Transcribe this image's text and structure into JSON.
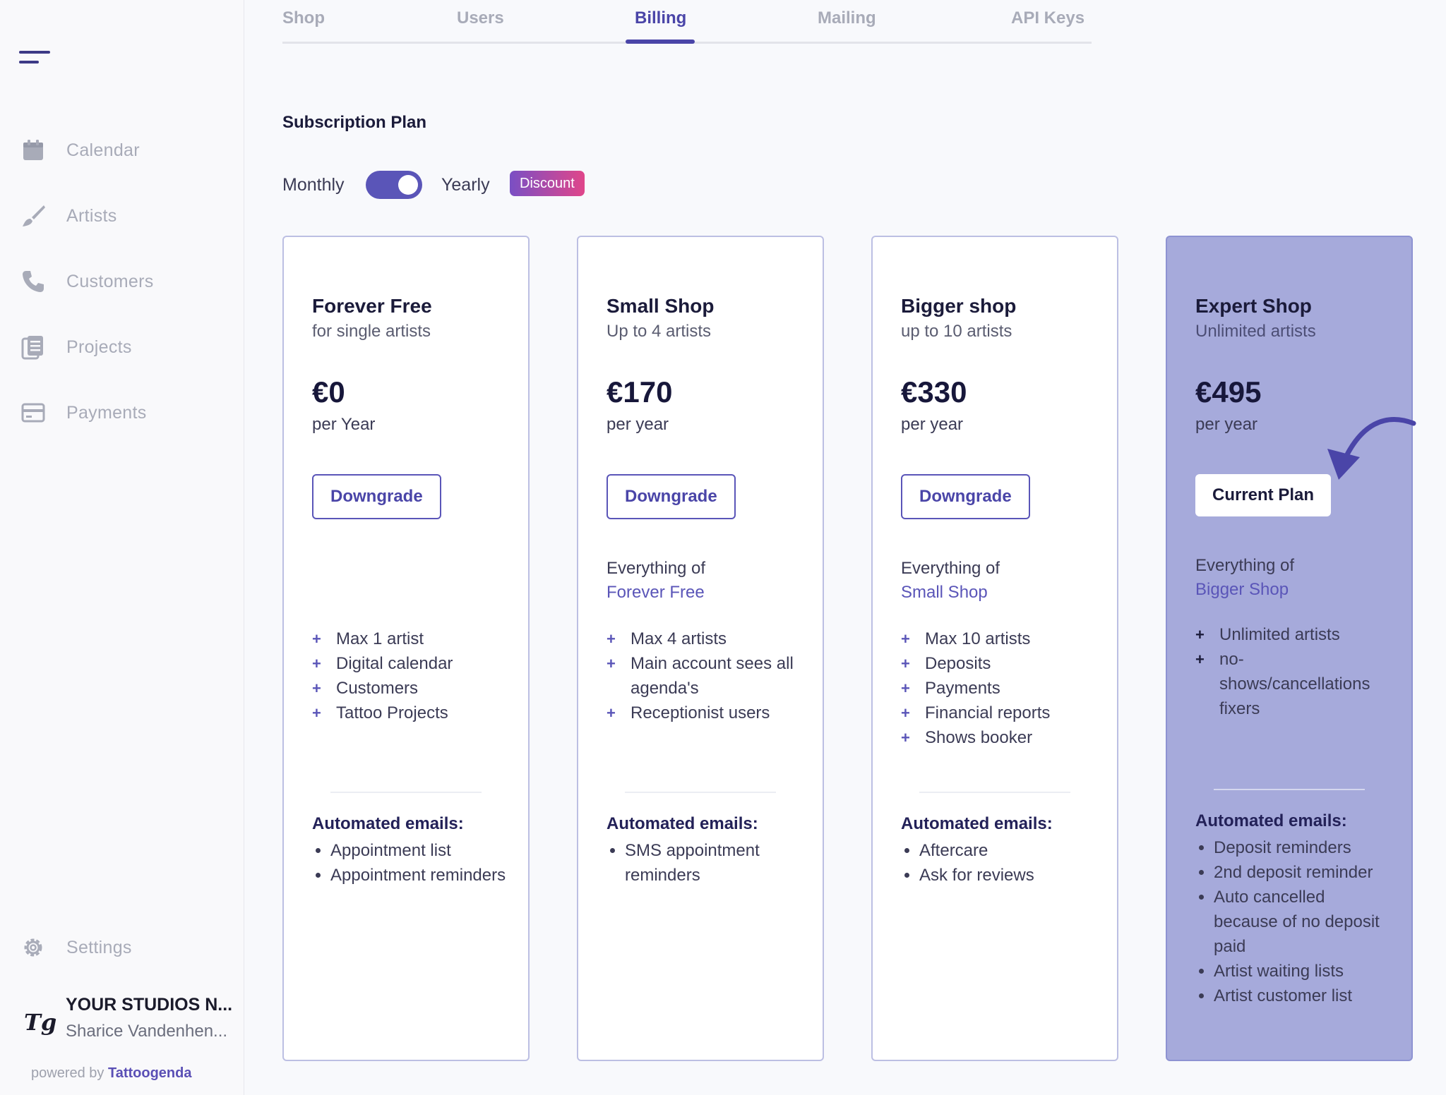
{
  "sidebar": {
    "items": [
      {
        "label": "Calendar",
        "icon": "calendar-icon"
      },
      {
        "label": "Artists",
        "icon": "brush-icon"
      },
      {
        "label": "Customers",
        "icon": "phone-icon"
      },
      {
        "label": "Projects",
        "icon": "document-icon"
      },
      {
        "label": "Payments",
        "icon": "card-icon"
      }
    ],
    "settings_label": "Settings",
    "studio_name": "YOUR STUDIOS N...",
    "studio_user": "Sharice Vandenhen...",
    "studio_logo": "Tg",
    "powered_prefix": "powered by",
    "powered_brand": "Tattoogenda"
  },
  "tabs": [
    "Shop",
    "Users",
    "Billing",
    "Mailing",
    "API Keys"
  ],
  "active_tab": "Billing",
  "subscription": {
    "title": "Subscription Plan",
    "monthly_label": "Monthly",
    "yearly_label": "Yearly",
    "discount_badge": "Discount",
    "yearly_selected": true
  },
  "plans": [
    {
      "name": "Forever Free",
      "sub": "for single artists",
      "price": "€0",
      "period": "per Year",
      "button": "Downgrade",
      "includes_prefix": "",
      "includes_plan": "",
      "features": [
        "Max 1 artist",
        "Digital calendar",
        "Customers",
        "Tattoo Projects"
      ],
      "emails_title": "Automated emails:",
      "emails": [
        "Appointment list",
        "Appointment reminders"
      ]
    },
    {
      "name": "Small Shop",
      "sub": "Up to 4 artists",
      "price": "€170",
      "period": "per year",
      "button": "Downgrade",
      "includes_prefix": "Everything of",
      "includes_plan": "Forever Free",
      "features": [
        "Max 4 artists",
        "Main account sees all agenda's",
        "Receptionist users"
      ],
      "emails_title": "Automated emails:",
      "emails": [
        "SMS appointment reminders"
      ]
    },
    {
      "name": "Bigger shop",
      "sub": "up to 10 artists",
      "price": "€330",
      "period": "per year",
      "button": "Downgrade",
      "includes_prefix": "Everything of",
      "includes_plan": "Small Shop",
      "features": [
        "Max 10 artists",
        "Deposits",
        "Payments",
        "Financial reports",
        "Shows booker"
      ],
      "emails_title": "Automated emails:",
      "emails": [
        "Aftercare",
        "Ask for reviews"
      ]
    },
    {
      "name": "Expert Shop",
      "sub": "Unlimited artists",
      "price": "€495",
      "period": "per year",
      "button": "Current Plan",
      "includes_prefix": "Everything of",
      "includes_plan": "Bigger Shop",
      "features": [
        "Unlimited artists",
        "no-shows/cancellations fixers"
      ],
      "emails_title": "Automated emails:",
      "emails": [
        "Deposit reminders",
        "2nd deposit reminder",
        "Auto cancelled because of no deposit paid",
        "Artist waiting lists",
        "Artist customer list"
      ]
    }
  ],
  "colors": {
    "accent": "#4a45a8",
    "current_plan_bg": "#a6aadb",
    "badge_start": "#7a4fc4",
    "badge_end": "#e0468a"
  }
}
